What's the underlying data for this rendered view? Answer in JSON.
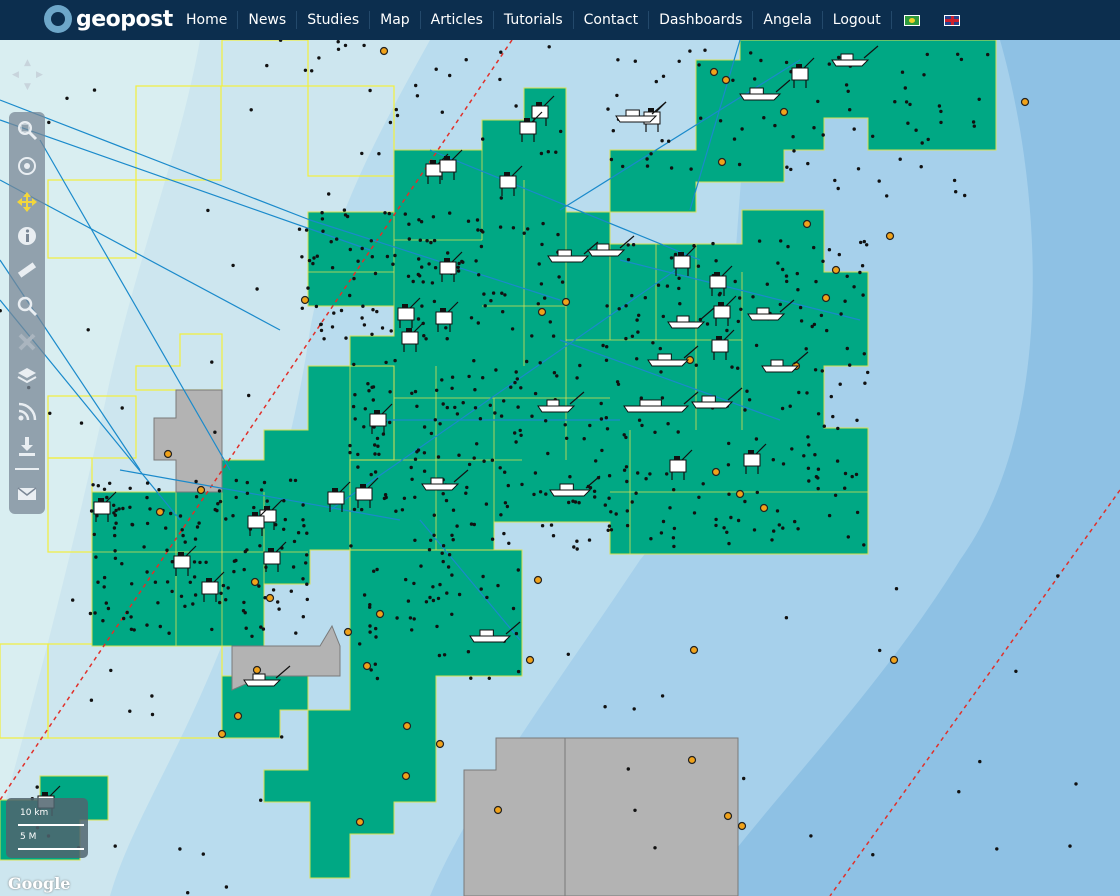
{
  "brand": {
    "name": "geopost"
  },
  "nav": {
    "items": [
      "Home",
      "News",
      "Studies",
      "Map",
      "Articles",
      "Tutorials",
      "Contact",
      "Dashboards",
      "Angela",
      "Logout"
    ],
    "flags": [
      "brazil-flag-icon",
      "uk-flag-icon"
    ]
  },
  "map": {
    "toolbar": [
      "zoom-box-icon",
      "zoom-extent-icon",
      "pan-icon",
      "info-icon",
      "measure-icon",
      "search-icon",
      "clear-icon",
      "layers-icon",
      "rss-icon",
      "download-icon",
      "email-icon"
    ],
    "pan_arrows": [
      "▲",
      "◀",
      "▶",
      "▼"
    ],
    "scale_km": "10 km",
    "scale_mi": "5 M",
    "attribution": "Google",
    "colors": {
      "sea_light": "#d4e8ec",
      "sea_mid": "#b3d8ec",
      "sea_deep": "#8ec1e4",
      "block_green": "#00a884",
      "block_border": "#d8e050",
      "grey_block": "#b3b3b3",
      "survey_line": "#1a8acb",
      "dashed_line": "#e0302a",
      "yellow_outline": "#f2ef3c"
    }
  }
}
